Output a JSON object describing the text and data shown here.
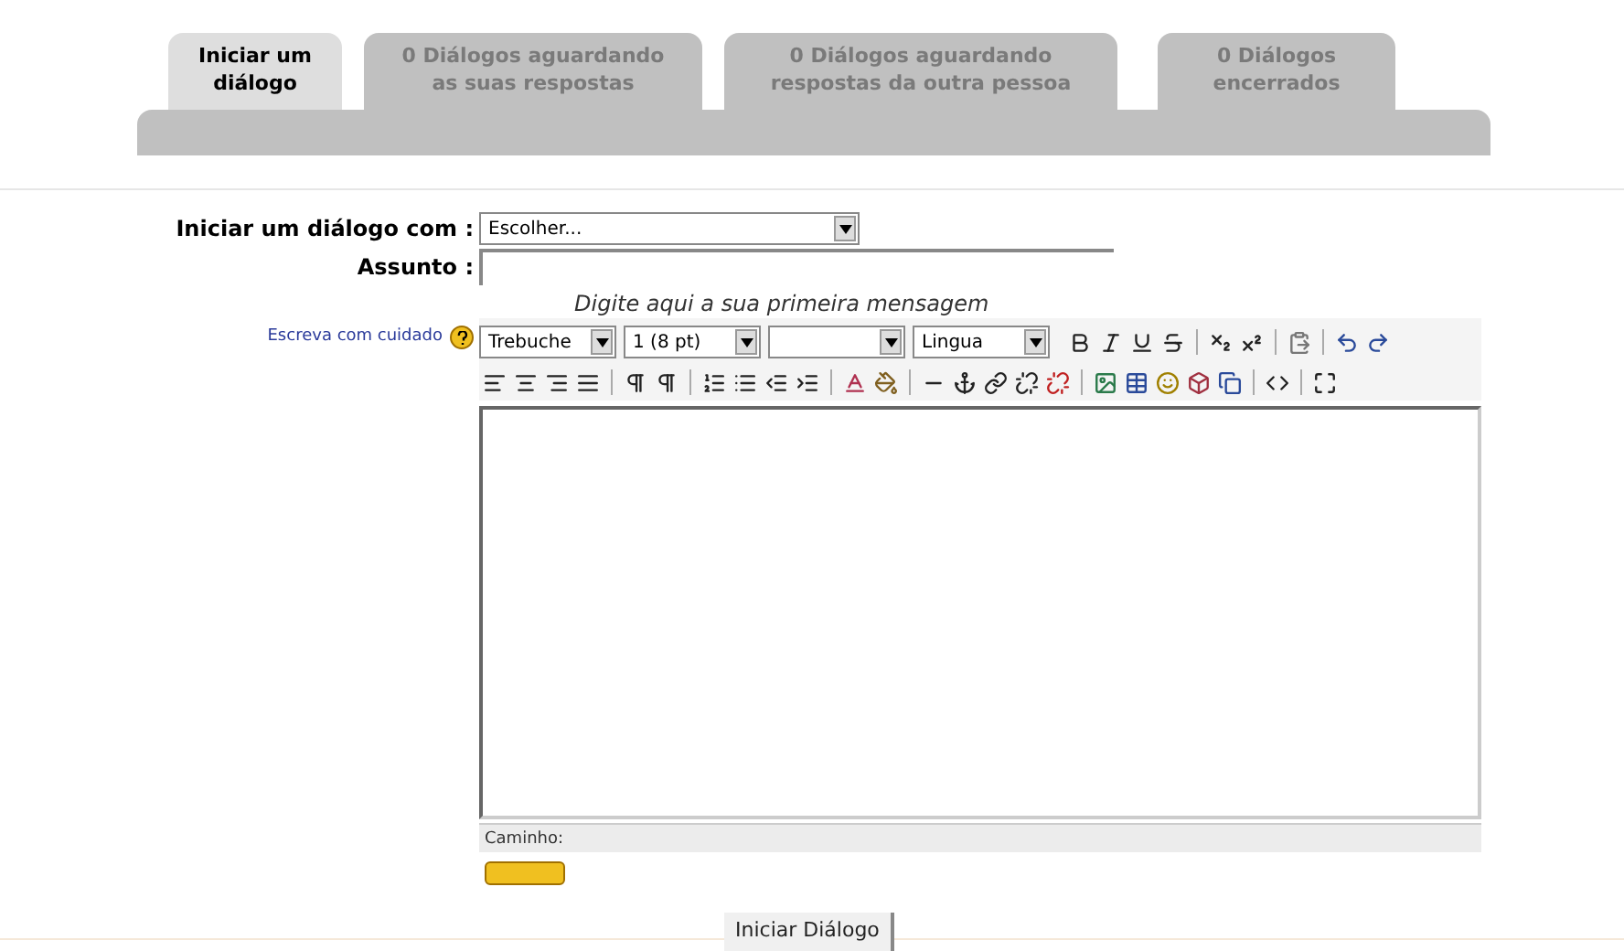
{
  "tabs": [
    {
      "label": "Iniciar um diálogo",
      "selected": true
    },
    {
      "label": "0 Diálogos aguardando as suas respostas",
      "selected": false
    },
    {
      "label": "0 Diálogos aguardando respostas da outra pessoa",
      "selected": false
    },
    {
      "label": "0 Diálogos encerrados",
      "selected": false
    }
  ],
  "form": {
    "recipient": {
      "label": "Iniciar um diálogo com :",
      "value": "Escolher..."
    },
    "subject": {
      "label": "Assunto :"
    },
    "message_hint": "Digite aqui a sua primeira mensagem",
    "help_link": "Escreva com cuidado",
    "editor": {
      "font": "Trebuche",
      "size": "1 (8 pt)",
      "language": "Lingua",
      "path_label": "Caminho:"
    },
    "submit": "Iniciar Diálogo"
  }
}
